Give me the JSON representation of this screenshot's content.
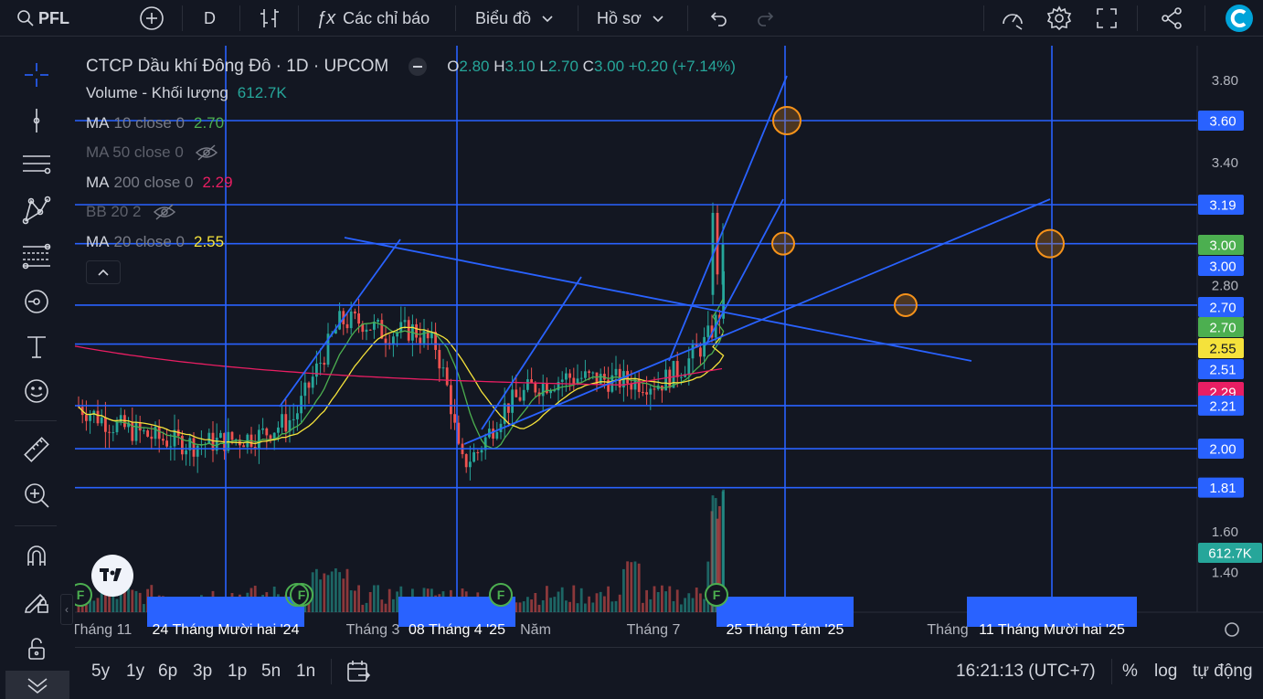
{
  "toolbar": {
    "symbol": "PFL",
    "interval": "D",
    "indicators_label": "Các chỉ báo",
    "chart_label": "Biểu đồ",
    "profile_label": "Hồ sơ"
  },
  "legend": {
    "title": "CTCP Dầu khí Đông Đô · 1D · UPCOM",
    "ohlc": {
      "o_label": "O",
      "o": "2.80",
      "h_label": "H",
      "h": "3.10",
      "l_label": "L",
      "l": "2.70",
      "c_label": "C",
      "c": "3.00",
      "change": "+0.20 (+7.14%)"
    },
    "volume_label": "Volume - Khối lượng",
    "volume_value": "612.7K",
    "ma10_name": "MA",
    "ma10_params": "10 close 0",
    "ma10_value": "2.70",
    "ma50_name": "MA 50 close 0",
    "ma200_name": "MA",
    "ma200_params": "200 close 0",
    "ma200_value": "2.29",
    "bb_name": "BB 20 2",
    "ma20_name": "MA",
    "ma20_params": "20 close 0",
    "ma20_value": "2.55"
  },
  "colors": {
    "background": "#131722",
    "up": "#26a69a",
    "down": "#ef5350",
    "drawing": "#2962ff",
    "ma10": "#4caf50",
    "ma20": "#f5e23b",
    "ma200": "#e91e63",
    "marker": "#f7931a"
  },
  "chart_data": {
    "type": "candlestick",
    "ylim": [
      1.25,
      3.9
    ],
    "y_ticks": [
      "3.80",
      "3.40",
      "2.80",
      "1.60",
      "1.40"
    ],
    "price_badges": [
      "3.60",
      "3.19",
      "3.00",
      "3.00",
      "2.70",
      "2.70",
      "2.55",
      "2.51",
      "2.29",
      "2.21",
      "2.00",
      "1.81",
      "612.7K"
    ],
    "horizontal_levels": [
      3.6,
      3.19,
      3.0,
      2.7,
      2.51,
      2.21,
      2.0,
      1.81
    ],
    "x_labels": [
      "Tháng 11",
      "24 Tháng Mười hai '24",
      "Tháng 3",
      "08 Tháng 4 '25",
      "Năm",
      "Tháng 7",
      "25 Tháng Tám '25",
      "Tháng",
      "11 Tháng Mười hai '25"
    ],
    "vertical_markers": [
      "24 Tháng Mười hai '24",
      "08 Tháng 4 '25",
      "25 Tháng Tám '25",
      "11 Tháng Mười hai '25"
    ],
    "price_marks": [
      3.6,
      3.0,
      2.7,
      3.0
    ],
    "last_close": 3.0,
    "last_volume": "612.7K"
  },
  "bottom": {
    "ranges": [
      "5y",
      "1y",
      "6p",
      "3p",
      "1p",
      "5n",
      "1n"
    ],
    "time": "16:21:13 (UTC+7)",
    "percent": "%",
    "log": "log",
    "auto": "tự động"
  }
}
